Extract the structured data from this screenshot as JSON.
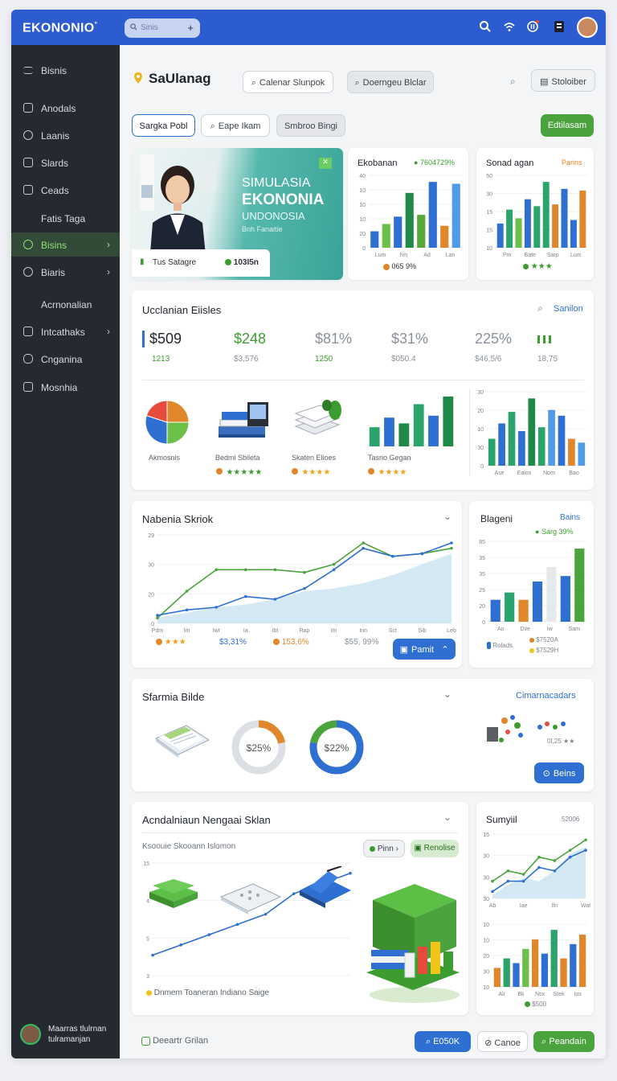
{
  "app": {
    "logo": "EKONONIO",
    "logo_mark": "°"
  },
  "topbar": {
    "search_placeholder": "Sinis",
    "search_plus": "+"
  },
  "sidebar": {
    "items": [
      {
        "label": "Bisnis",
        "chevron": false
      },
      {
        "label": "Anodals",
        "chevron": false
      },
      {
        "label": "Laanis",
        "chevron": false
      },
      {
        "label": "Slards",
        "chevron": false
      },
      {
        "label": "Ceads",
        "chevron": false
      },
      {
        "label": "Fatis Taga",
        "chevron": false
      },
      {
        "label": "Bisins",
        "chevron": true
      },
      {
        "label": "Biaris",
        "chevron": true
      },
      {
        "label": "Acrnonalian",
        "chevron": false
      },
      {
        "label": "Intcathaks",
        "chevron": true
      },
      {
        "label": "Cnganina",
        "chevron": false
      },
      {
        "label": "Mosnhia",
        "chevron": false
      }
    ],
    "user": {
      "name_line1": "Maarras tlulrnan",
      "name_line2": "tulramanjan"
    }
  },
  "header": {
    "title": "SaUlanag",
    "filter1": "Calenar Slunpok",
    "filter2": "Doerngeu Blclar",
    "right_button": "Stoloiber"
  },
  "tabs": [
    {
      "label": "Sargka Pobl",
      "active": true
    },
    {
      "label": "Eape Ikam",
      "active": false
    },
    {
      "label": "Smbroo Bingi",
      "active": false
    }
  ],
  "action_button": "Edtilasam",
  "hero": {
    "line1": "SIMULASIA",
    "line2": "EKONONIA",
    "line3": "UNDONOSIA",
    "line4": "Bnh Fanaitie",
    "badge_label": "Tus Satagre",
    "badge_value": "103I5n",
    "corner": "✕"
  },
  "card_ekobanan": {
    "title": "Ekobanan",
    "badge": "7604729%",
    "footer": "065 9%",
    "chart_data": {
      "type": "bar",
      "categories": [
        "Lum",
        "fvn",
        "Ad",
        "Lan"
      ],
      "yticks": [
        "40",
        "10",
        "10",
        "10",
        "20",
        "0"
      ],
      "values": [
        9,
        13,
        17,
        30,
        18,
        36,
        12,
        35
      ],
      "colors": [
        "#2f6fd1",
        "#6cc04a",
        "#2f6fd1",
        "#1f8a47",
        "#5aa83a",
        "#2f6fd1",
        "#e0862b",
        "#4f9be8"
      ]
    }
  },
  "card_sonad": {
    "title": "Sonad agan",
    "link": "Parins",
    "footer": "★★★",
    "chart_data": {
      "type": "bar",
      "categories": [
        "Pm",
        "Bate",
        "Sarp",
        "Lum"
      ],
      "yticks": [
        "50",
        "30",
        "15",
        "15",
        "10"
      ],
      "values": [
        14,
        22,
        17,
        28,
        24,
        38,
        25,
        34,
        16,
        33
      ],
      "colors": [
        "#2f6fd1",
        "#2aa36d",
        "#6cc04a",
        "#2f6fd1",
        "#2aa36d",
        "#2aa36d",
        "#e0862b",
        "#2f6fd1",
        "#2f6fd1",
        "#e0862b"
      ]
    }
  },
  "overview": {
    "title": "Ucclanian Eiisles",
    "link": "Sanilon",
    "kpis": [
      {
        "value": "$509",
        "sub": "1213",
        "color": "#1f242b",
        "subcolor": "#3d9c30"
      },
      {
        "value": "$248",
        "sub": "$3,576",
        "color": "#3d9c30",
        "subcolor": "#8a919b"
      },
      {
        "value": "$81%",
        "sub": "1250",
        "color": "#8a919b",
        "subcolor": "#3d9c30"
      },
      {
        "value": "$31%",
        "sub": "$050.4",
        "color": "#8a919b",
        "subcolor": "#8a919b"
      },
      {
        "value": "225%",
        "sub": "$46,5/6",
        "color": "#8a919b",
        "subcolor": "#8a919b"
      },
      {
        "value": "",
        "sub": "18,75",
        "color": "#3d9c30",
        "subcolor": "#8a919b"
      }
    ],
    "widgets": [
      {
        "label": "Akmosnis",
        "stars": ""
      },
      {
        "label": "Bedmi Sbileta",
        "stars": "★★★★★"
      },
      {
        "label": "Skaten Elioes",
        "stars": "★★★★"
      },
      {
        "label": "Tasrio Gegan",
        "stars": "★★★★"
      }
    ],
    "pie_chart": {
      "type": "pie",
      "values": [
        25,
        25,
        30,
        20
      ],
      "colors": [
        "#e0862b",
        "#6cc04a",
        "#2f6fd1",
        "#e64b3c"
      ]
    },
    "mini_bars": {
      "type": "bar",
      "values": [
        10,
        15,
        12,
        22,
        16,
        26
      ],
      "colors": [
        "#2aa36d",
        "#2f6fd1",
        "#1f8a47",
        "#2aa36d",
        "#2f6fd1",
        "#1f8a47"
      ]
    },
    "chart_data": {
      "type": "bar",
      "categories": [
        "Ase",
        "Ealos",
        "Nom",
        "Bao"
      ],
      "yticks": [
        "30",
        "20",
        "10",
        "30",
        "0"
      ],
      "values": [
        14,
        22,
        28,
        18,
        35,
        20,
        29,
        26,
        14,
        12
      ],
      "colors": [
        "#2aa36d",
        "#2f6fd1",
        "#2aa36d",
        "#2f6fd1",
        "#1f8a47",
        "#2aa36d",
        "#4f9be8",
        "#2f6fd1",
        "#e0862b",
        "#4f9be8"
      ]
    }
  },
  "line_card": {
    "title": "Nabenia Skriok",
    "footer": [
      {
        "text": "★★★",
        "kind": "stars"
      },
      {
        "text": "$3,31%",
        "kind": "blue"
      },
      {
        "text": "153,6%",
        "kind": "orange"
      },
      {
        "text": "$55, 99%",
        "kind": "muted"
      }
    ],
    "button": "Pamit",
    "chart_data": {
      "type": "line",
      "x": [
        "Pdm",
        "Im",
        "Iwt",
        "Ia",
        "Ibt",
        "Rap",
        "Im",
        "Inn",
        "Sct",
        "Sib",
        "Leb"
      ],
      "yticks": [
        "29",
        "30",
        "20",
        "0"
      ],
      "ylim": [
        0,
        30
      ],
      "series": [
        {
          "values": [
            2,
            4,
            6,
            7,
            9,
            12,
            13,
            15,
            18,
            22,
            26
          ],
          "color": "#cbe3f2",
          "kind": "area"
        },
        {
          "values": [
            2,
            12,
            20,
            20,
            20,
            19,
            22,
            30,
            25,
            26,
            28
          ],
          "color": "#4aa33c",
          "kind": "line"
        },
        {
          "values": [
            3,
            5,
            6,
            10,
            9,
            13,
            20,
            28,
            25,
            26,
            30
          ],
          "color": "#2f6fd1",
          "kind": "line"
        }
      ]
    }
  },
  "blageni_card": {
    "title": "Blageni",
    "link": "Bains",
    "badge": "Sarg 39%",
    "legend": [
      {
        "color": "#2f6fd1",
        "text": "Rolads"
      },
      {
        "color": "#e0862b",
        "text": "$7520A"
      },
      {
        "color": "#f0c419",
        "text": "$7529H"
      }
    ],
    "chart_data": {
      "type": "bar",
      "categories": [
        "Ao",
        "Dve",
        "Iw",
        "Sam"
      ],
      "yticks": [
        "85",
        "35",
        "35",
        "25",
        "20",
        "0"
      ],
      "values": [
        12,
        16,
        12,
        22,
        30,
        25,
        40
      ],
      "colors": [
        "#2f6fd1",
        "#2aa36d",
        "#e0862b",
        "#2f6fd1",
        "#e6e8eb",
        "#2f6fd1",
        "#4aa33c"
      ]
    }
  },
  "sfarmia_card": {
    "title": "Sfarmia Bilde",
    "link": "Cimarnacadars",
    "donut1": {
      "label": "$25%",
      "value": 22,
      "color": "#e0862b"
    },
    "donut2": {
      "label": "$22%",
      "value": 78,
      "color": "#2f6fd1"
    },
    "stat": "0I,25 ★★",
    "button": "Beins"
  },
  "bottom_card": {
    "title": "Acndalniaun Nengaai Sklan",
    "subtitle": "Ksoouie Skooann Islomon",
    "pill1": "Pinn",
    "pill2": "Renolise",
    "legend": "Dnmem Toaneran Indiano Saige",
    "chart_data": {
      "type": "line",
      "yticks": [
        "15",
        "4",
        "5",
        "3"
      ],
      "series": [
        {
          "values": [
            2,
            3,
            4,
            5,
            6,
            8,
            9,
            10
          ],
          "color": "#2f6fd1"
        }
      ]
    }
  },
  "summit_card": {
    "title": "Sumyiil",
    "value": "52006",
    "line_chart": {
      "type": "line",
      "x": [
        "Ab",
        "Iae",
        "Ifn",
        "Wat"
      ],
      "yticks": [
        "15",
        "30",
        "30",
        "30"
      ],
      "series": [
        {
          "values": [
            2,
            8,
            12,
            10,
            16,
            26,
            30
          ],
          "color": "#cbe3f2",
          "kind": "area"
        },
        {
          "values": [
            10,
            16,
            14,
            24,
            22,
            28,
            34
          ],
          "color": "#4aa33c",
          "kind": "line"
        },
        {
          "values": [
            4,
            10,
            10,
            18,
            16,
            24,
            28
          ],
          "color": "#2f6fd1",
          "kind": "line"
        }
      ]
    },
    "bar_chart": {
      "type": "bar",
      "x": [
        "Alr",
        "Bk",
        "Nsx",
        "Stek",
        "Ios"
      ],
      "yticks": [
        "10",
        "10",
        "20",
        "30",
        "10"
      ],
      "values": [
        8,
        12,
        10,
        16,
        20,
        14,
        24,
        12,
        18,
        22
      ],
      "colors": [
        "#e0862b",
        "#2aa36d",
        "#2f6fd1",
        "#6cc04a",
        "#e0862b",
        "#2f6fd1",
        "#2aa36d",
        "#e0862b",
        "#2f6fd1",
        "#e0862b"
      ]
    },
    "footer": "$500"
  },
  "footer": {
    "label": "Deeartr Grilan",
    "btn1": "E050K",
    "btn2": "Canoe",
    "btn3": "Peandain"
  }
}
